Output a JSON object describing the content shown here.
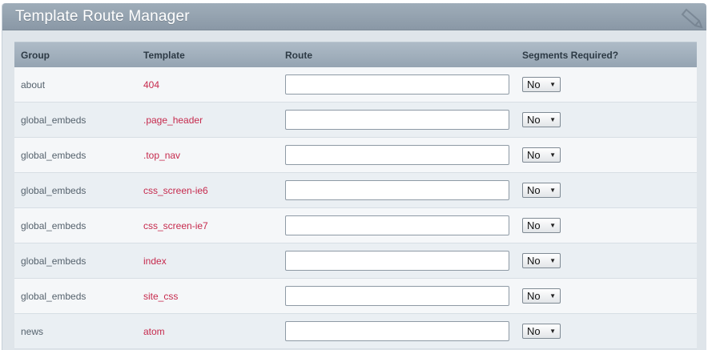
{
  "panel": {
    "title": "Template Route Manager",
    "icon": "pencil-icon"
  },
  "columns": {
    "group": "Group",
    "template": "Template",
    "route": "Route",
    "segments": "Segments Required?"
  },
  "rows": [
    {
      "group": "about",
      "template": "404",
      "route": "",
      "segments": "No"
    },
    {
      "group": "global_embeds",
      "template": ".page_header",
      "route": "",
      "segments": "No"
    },
    {
      "group": "global_embeds",
      "template": ".top_nav",
      "route": "",
      "segments": "No"
    },
    {
      "group": "global_embeds",
      "template": "css_screen-ie6",
      "route": "",
      "segments": "No"
    },
    {
      "group": "global_embeds",
      "template": "css_screen-ie7",
      "route": "",
      "segments": "No"
    },
    {
      "group": "global_embeds",
      "template": "index",
      "route": "",
      "segments": "No"
    },
    {
      "group": "global_embeds",
      "template": "site_css",
      "route": "",
      "segments": "No"
    },
    {
      "group": "news",
      "template": "atom",
      "route": "",
      "segments": "No"
    }
  ],
  "colors": {
    "template_link": "#c62a4d",
    "header_bar": "#8a98a6"
  }
}
